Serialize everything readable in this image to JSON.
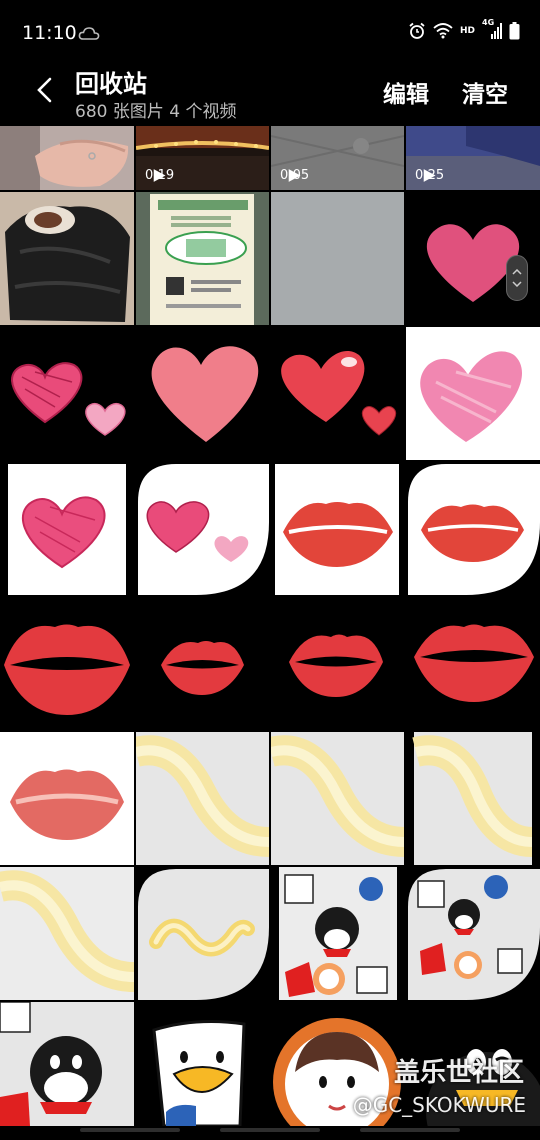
{
  "status_bar": {
    "time": "11:10",
    "network": "HD",
    "network_gen": "4G",
    "icons": [
      "cloud-icon",
      "alarm-icon",
      "wifi-icon",
      "signal-icon",
      "battery-icon"
    ]
  },
  "header": {
    "title": "回收站",
    "subtitle": "680 张图片 4 个视频",
    "edit_label": "编辑",
    "clear_label": "清空"
  },
  "videos": [
    {
      "duration": "0:19"
    },
    {
      "duration": "0:05"
    },
    {
      "duration": "0:25"
    }
  ],
  "watermark": {
    "cn": "盖乐世社区",
    "en": "@GC_SKOKWURE"
  },
  "colors": {
    "background": "#000000",
    "subtitle": "#bdbdbd",
    "heart_pink": "#e0517d",
    "lip_red": "#e2453a"
  }
}
